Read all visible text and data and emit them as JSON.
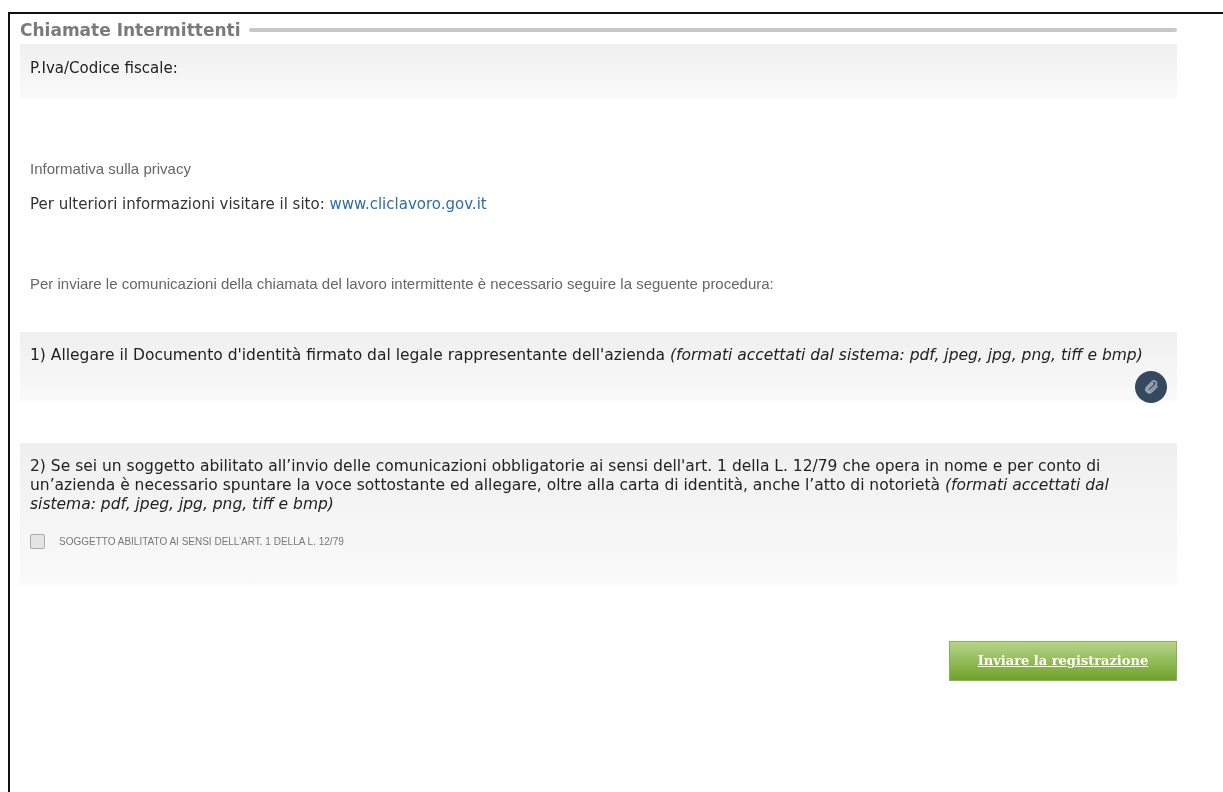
{
  "title": "Chiamate Intermittenti",
  "fiscal_code": {
    "label": "P.Iva/Codice fiscale:"
  },
  "privacy": {
    "title": "Informativa sulla privacy",
    "text": "Per ulteriori informazioni visitare il sito:",
    "link": "www.cliclavoro.gov.it"
  },
  "procedure_intro": "Per inviare le comunicazioni della chiamata del lavoro intermittente è necessario seguire la seguente procedura:",
  "steps": [
    {
      "kind": "attach",
      "text": "1) Allegare il Documento d'identità firmato dal legale rappresentante dell'azienda *(formati accettati dal sistema: pdf, jpeg, jpg, png, tiff e bmp)*"
    },
    {
      "kind": "checkbox",
      "text": "2) Se sei un soggetto abilitato all’invio delle comunicazioni obbligatorie ai sensi dell'art. 1 della L. 12/79 che opera in nome e per conto di un’azienda è necessario spuntare la voce sottostante ed allegare, oltre alla carta di identità, anche l’atto di notorietà *(formati accettati dal sistema: pdf, jpeg, jpg, png, tiff e bmp)*",
      "checkbox": {
        "label": "SOGGETTO ABILITATO AI SENSI DELL’ART. 1 DELLA L. 12/79",
        "checked": false
      }
    }
  ],
  "submit_button": "Inviare la registrazione"
}
